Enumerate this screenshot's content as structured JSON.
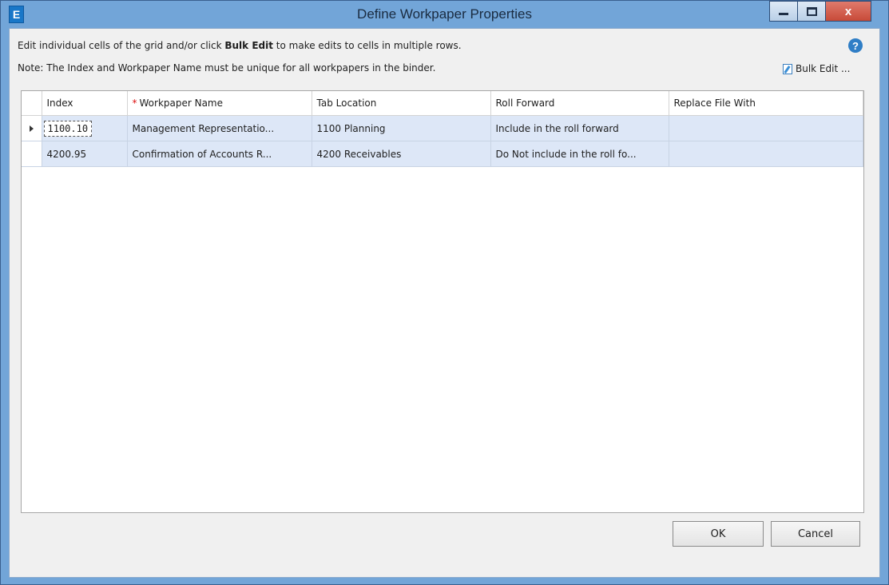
{
  "window": {
    "title": "Define Workpaper Properties",
    "app_icon_letter": "E",
    "close_glyph": "x"
  },
  "instructions": {
    "line1_prefix": "Edit individual cells of the grid and/or click ",
    "line1_bold": "Bulk Edit",
    "line1_suffix": " to make edits to cells in multiple rows.",
    "line2": "Note: The Index and Workpaper Name must be unique for all workpapers in the binder."
  },
  "help_icon_glyph": "?",
  "bulk_edit_label": "Bulk Edit ...",
  "grid": {
    "columns": {
      "index": "Index",
      "required_marker": "*",
      "workpaper_name": "Workpaper Name",
      "tab_location": "Tab Location",
      "roll_forward": "Roll Forward",
      "replace_file_with": "Replace File With"
    },
    "rows": [
      {
        "index": "1100.10",
        "workpaper_name": "Management Representatio...",
        "tab_location": "1100 Planning",
        "roll_forward": "Include in the roll forward",
        "replace_file_with": ""
      },
      {
        "index": "4200.95",
        "workpaper_name": "Confirmation of Accounts R...",
        "tab_location": "4200 Receivables",
        "roll_forward": "Do Not include in the roll fo...",
        "replace_file_with": ""
      }
    ]
  },
  "buttons": {
    "ok": "OK",
    "cancel": "Cancel"
  },
  "colors": {
    "titlebar": "#72a5d8",
    "close_button": "#c74a38",
    "selected_row": "#dde7f7",
    "required_star": "#dd1111"
  }
}
